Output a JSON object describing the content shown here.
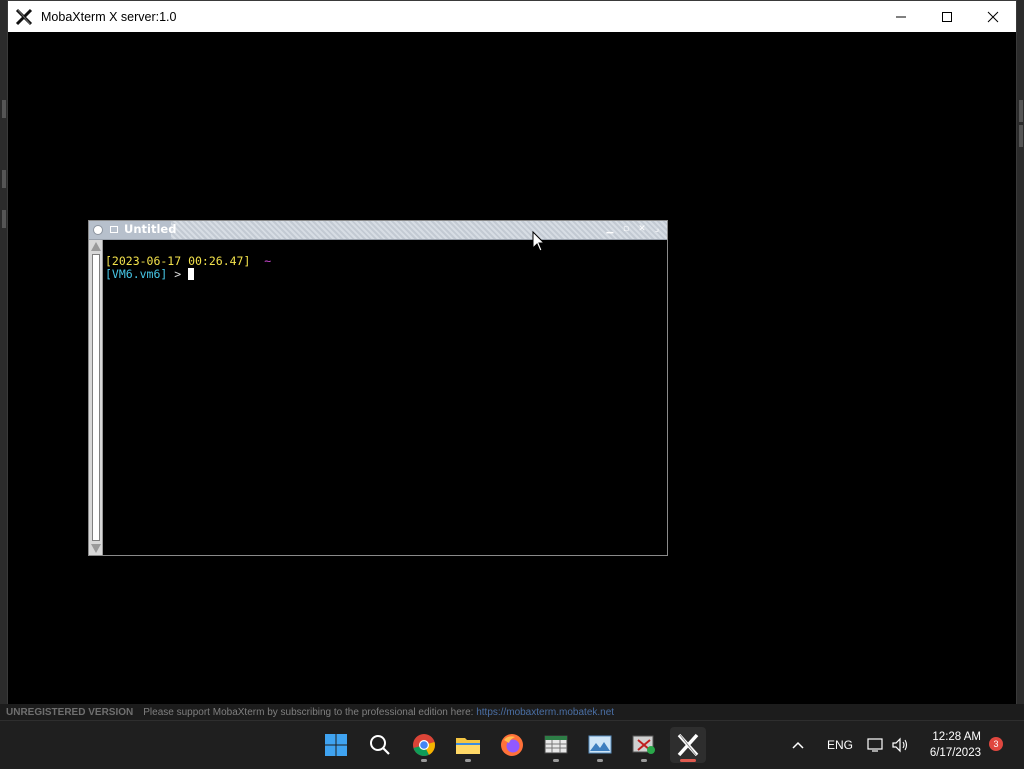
{
  "window": {
    "title": "MobaXterm X server:1.0",
    "minimize_icon": "minimize-icon",
    "maximize_icon": "maximize-icon",
    "close_icon": "close-icon"
  },
  "xterm": {
    "title": "Untitled",
    "timestamp": "[2023-06-17 00:26.47]",
    "tilde": "~",
    "host": "[VM6.vm6]",
    "prompt": " > "
  },
  "status_bar": {
    "unregistered": "UNREGISTERED VERSION",
    "message": "Please support MobaXterm by subscribing to the professional edition here:",
    "url": "https://mobaxterm.mobatek.net"
  },
  "taskbar": {
    "apps": [
      "start-icon",
      "search-icon",
      "chrome-icon",
      "file-explorer-icon",
      "firefox-icon",
      "spreadsheet-app-icon",
      "photos-app-icon",
      "snipping-tool-icon",
      "mobaxterm-icon"
    ],
    "language": "ENG",
    "time": "12:28 AM",
    "date": "6/17/2023",
    "notification_count": "3"
  },
  "colors": {
    "timestamp": "#f3e24c",
    "host": "#46c6e6",
    "tilde": "#d04ad8",
    "taskbar_bg": "#1f1f1f",
    "active_app_indicator": "#e05a4f"
  }
}
